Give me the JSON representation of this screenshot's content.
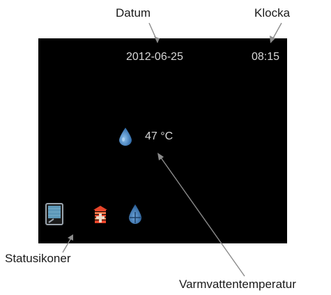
{
  "callouts": {
    "date": "Datum",
    "clock": "Klocka",
    "status_icons": "Statusikoner",
    "hot_water_temp": "Varmvattentemperatur"
  },
  "screen": {
    "date": "2012-06-25",
    "time": "08:15",
    "hot_water_temperature": "47 °C",
    "status_icons": [
      "display-icon",
      "heating-icon",
      "hot-water-icon"
    ]
  },
  "colors": {
    "screen_background": "#000000",
    "screen_text": "#d8d8d8",
    "water_drop": "#4a86c8",
    "heating_red": "#e8452a",
    "callout_line": "#8c8c8c"
  }
}
